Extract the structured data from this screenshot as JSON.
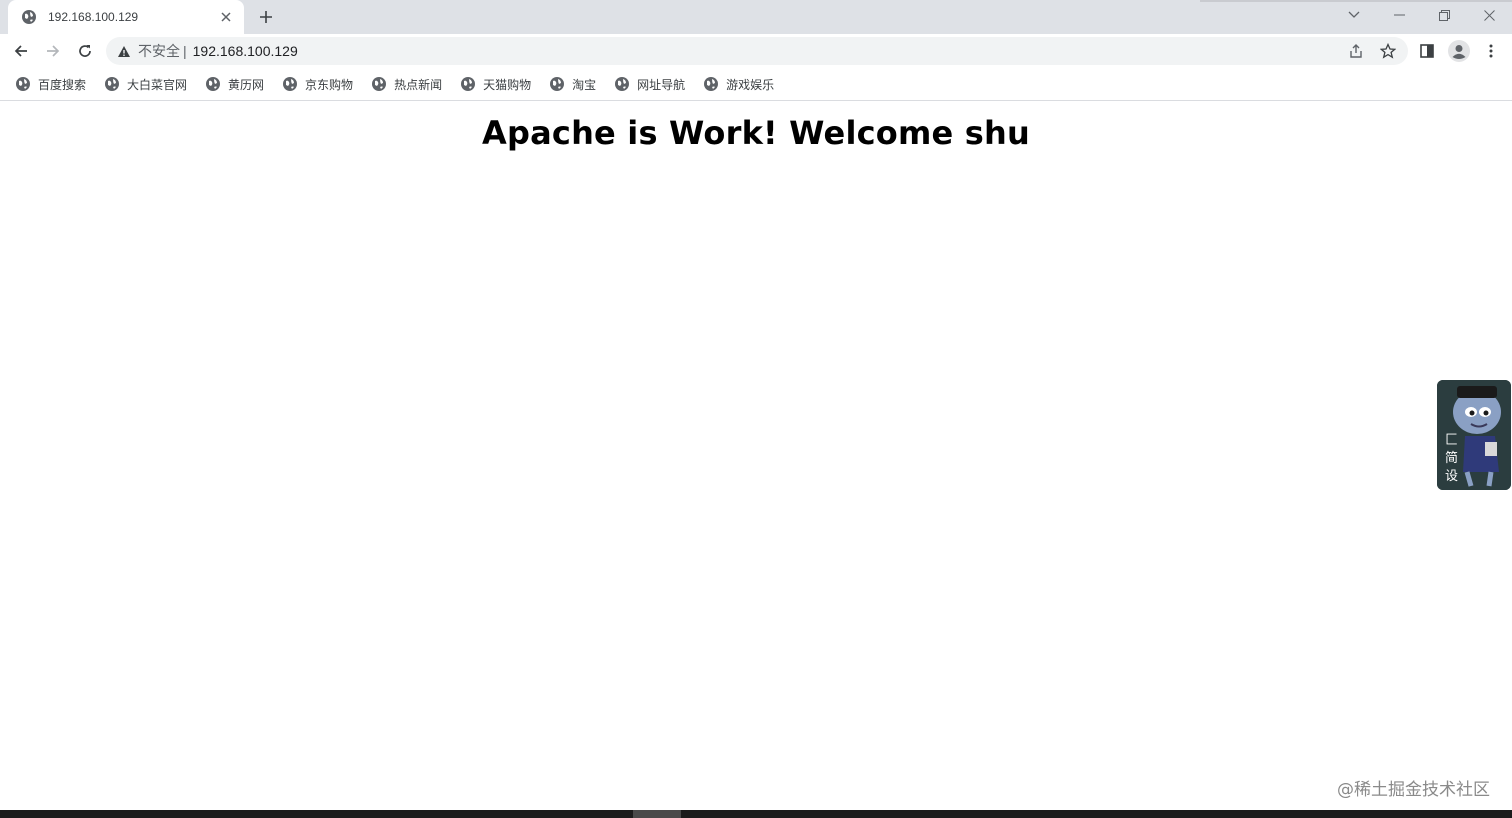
{
  "tab": {
    "title": "192.168.100.129",
    "favicon": "globe-icon",
    "close_icon": "close-icon"
  },
  "new_tab_icon": "plus-icon",
  "window_controls": [
    "chevron-down-icon",
    "minimize-icon",
    "restore-icon",
    "close-icon"
  ],
  "toolbar": {
    "back_icon": "back-arrow-icon",
    "forward_icon": "forward-arrow-icon",
    "reload_icon": "reload-icon",
    "security_icon": "warning-triangle-icon",
    "security_label": "不安全",
    "separator": "|",
    "url": "192.168.100.129",
    "share_icon": "share-icon",
    "bookmark_icon": "star-icon",
    "side_panel_icon": "side-panel-icon",
    "profile_icon": "profile-avatar-icon",
    "menu_icon": "kebab-menu-icon"
  },
  "bookmarks": [
    {
      "label": "百度搜索",
      "icon": "globe-icon"
    },
    {
      "label": "大白菜官网",
      "icon": "globe-icon"
    },
    {
      "label": "黄历网",
      "icon": "globe-icon"
    },
    {
      "label": "京东购物",
      "icon": "globe-icon"
    },
    {
      "label": "热点新闻",
      "icon": "globe-icon"
    },
    {
      "label": "天猫购物",
      "icon": "globe-icon"
    },
    {
      "label": "淘宝",
      "icon": "globe-icon"
    },
    {
      "label": "网址导航",
      "icon": "globe-icon"
    },
    {
      "label": "游戏娱乐",
      "icon": "globe-icon"
    }
  ],
  "page": {
    "heading": "Apache is Work! Welcome shu"
  },
  "float_widget": {
    "text": "匚简设",
    "icon": "cartoon-character-icon"
  },
  "watermark": "@稀土掘金技术社区",
  "colors": {
    "tabstrip_bg": "#dee1e6",
    "omnibox_bg": "#f1f3f4",
    "icon_gray": "#5f6368",
    "heading": "#000000",
    "widget_bg": "#2b3d3f",
    "taskbar_bg": "#1c1c1c"
  }
}
